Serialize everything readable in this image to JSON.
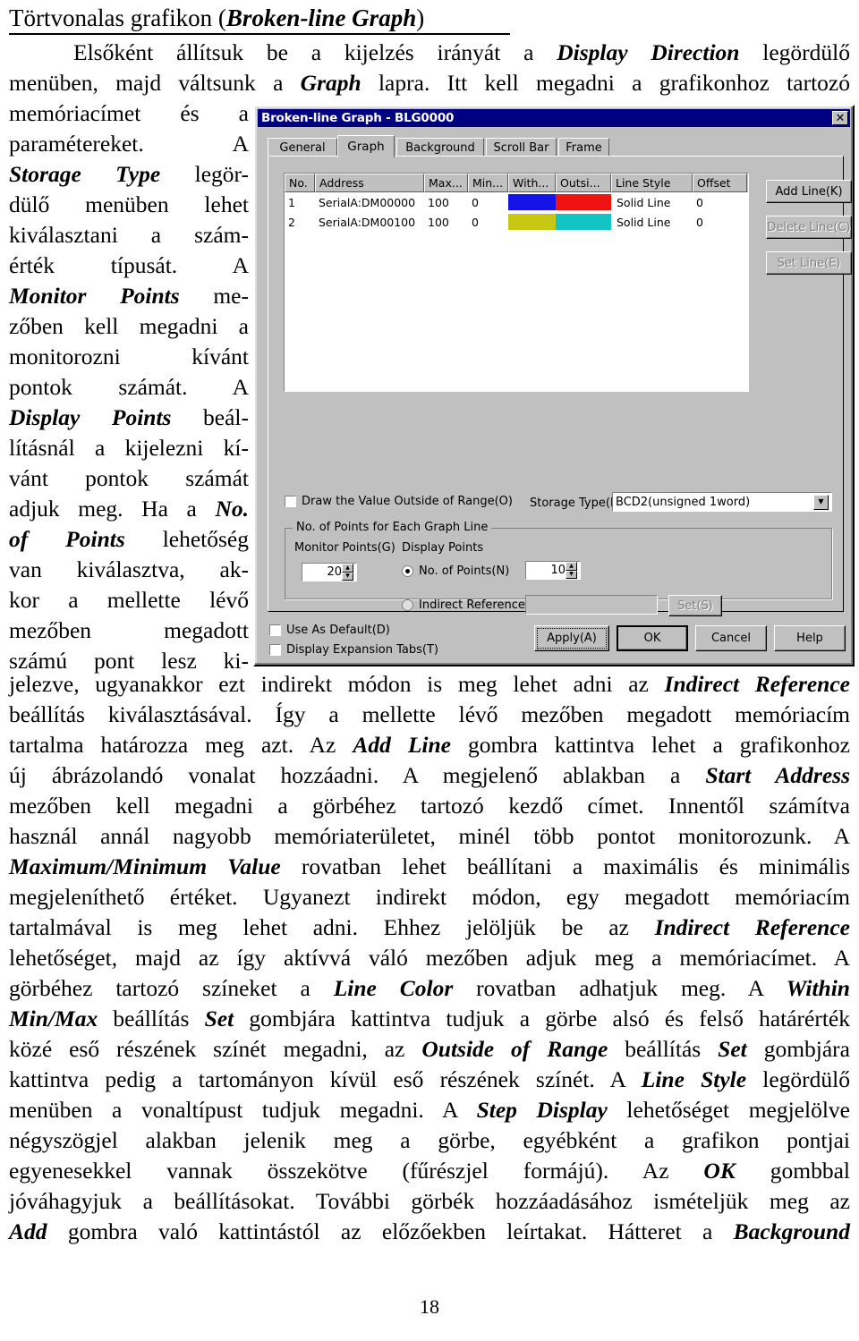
{
  "heading": {
    "text_before": "Törtvonalas grafikon (",
    "emphasis": "Broken-line Graph",
    "text_after": ")"
  },
  "paragraph_top": {
    "line1_a": "Elsőként állítsuk be a kijelzés irányát a ",
    "line1_em": "Display Direction",
    "line1_b": " legördülő",
    "line2_a": "menüben, majd váltsunk a ",
    "line2_em": "Graph",
    "line2_b": " lapra. Itt kell megadni a grafikonhoz tartozó",
    "line3": "memóriacímet és a"
  },
  "left_column": {
    "l1_a": "paramétereket.",
    "l1_b": "A",
    "l2_em": "Storage Type",
    "l2_b": "legör-",
    "l3": "dülő menüben lehet",
    "l4": "kiválasztani a szám-",
    "l5_a": "érték",
    "l5_b": "típusát.",
    "l5_c": "A",
    "l6_em": "Monitor Points",
    "l6_b": "me-",
    "l7": "zőben kell megadni a",
    "l8_a": "monitorozni",
    "l8_b": "kívánt",
    "l9_a": "pontok",
    "l9_b": "számát.",
    "l9_c": "A",
    "l10_em": "Display Points",
    "l10_b": "beál-",
    "l11": "lításnál a kijelezni kí-",
    "l12_a": "vánt",
    "l12_b": "pontok",
    "l12_c": "számát",
    "l13_a": "adjuk meg. Ha a ",
    "l13_em": "No.",
    "l14_em": "of Points",
    "l14_b": "lehetőség",
    "l15": "van kiválasztva, ak-",
    "l16": "kor a mellette lévő",
    "l17_a": "mezőben",
    "l17_b": "megadott",
    "l18": "számú pont lesz ki-"
  },
  "paragraph_bottom": {
    "b1_a": "jelezve, ugyanakkor ezt indirekt módon is meg lehet adni az ",
    "b1_em": "Indirect Reference",
    "b2": "beállítás kiválasztásával. Így a mellette lévő mezőben megadott memóriacím",
    "b3_a": "tartalma határozza meg azt. Az ",
    "b3_em": "Add Line",
    "b3_b": " gombra kattintva lehet a grafikonhoz",
    "b4_a": "új ábrázolandó vonalat hozzáadni. A megjelenő ablakban a ",
    "b4_em": "Start Address",
    "b5": "mezőben kell megadni a görbéhez tartozó kezdő címet. Innentől számítva",
    "b6": "használ annál nagyobb memóriaterületet, minél több pontot monitorozunk. A",
    "b7_em": "Maximum/Minimum Value",
    "b7_b": " rovatban lehet beállítani a maximális és minimális",
    "b8": "megjeleníthető értéket. Ugyanezt indirekt módon, egy megadott memóriacím",
    "b9_a": "tartalmával is meg lehet adni. Ehhez jelöljük be az ",
    "b9_em": "Indirect Reference",
    "b10": "lehetőséget, majd az így aktívvá váló mezőben adjuk meg a memóriacímet. A",
    "b11_a": "görbéhez tartozó színeket a ",
    "b11_em": "Line Color",
    "b11_b": " rovatban adhatjuk meg. A ",
    "b11_em2": "Within",
    "b12_em": "Min/Max",
    "b12_a": " beállítás ",
    "b12_em2": "Set",
    "b12_b": " gombjára kattintva tudjuk a görbe alsó és felső határérték",
    "b13_a": "közé eső részének színét megadni, az ",
    "b13_em": "Outside of Range",
    "b13_b": " beállítás ",
    "b13_em2": "Set",
    "b13_c": " gombjára",
    "b14_a": "kattintva pedig a tartományon kívül eső részének színét. A ",
    "b14_em": "Line Style",
    "b14_b": " legördülő",
    "b15_a": "menüben a vonaltípust tudjuk megadni. A ",
    "b15_em": "Step Display",
    "b15_b": " lehetőséget megjelölve",
    "b16": "négyszögjel alakban jelenik meg a görbe, egyébként a grafikon pontjai",
    "b17_a": "egyenesekkel vannak összekötve (fűrészjel formájú). Az ",
    "b17_em": "OK",
    "b17_b": " gombbal",
    "b18": "jóváhagyjuk a beállításokat. További görbék hozzáadásához ismételjük meg az",
    "b19_em": "Add",
    "b19_a": " gombra való kattintástól az előzőekben leírtakat. Hátteret a ",
    "b19_em2": "Background"
  },
  "page_number": "18",
  "dialog": {
    "title": "Broken-line Graph - BLG0000",
    "close_label": "✕",
    "tabs": [
      {
        "label": "General",
        "active": false
      },
      {
        "label": "Graph",
        "active": true
      },
      {
        "label": "Background",
        "active": false
      },
      {
        "label": "Scroll Bar",
        "active": false
      },
      {
        "label": "Frame",
        "active": false
      }
    ],
    "table": {
      "columns": [
        "No.",
        "Address",
        "Max...",
        "Min...",
        "With...",
        "Outsi...",
        "Line Style",
        "Offset"
      ],
      "rows": [
        {
          "no": "1",
          "address": "SerialA:DM00000",
          "max": "100",
          "min": "0",
          "within_color": "#1414e6",
          "outside_color": "#ef1414",
          "line_style": "Solid Line",
          "offset": "0"
        },
        {
          "no": "2",
          "address": "SerialA:DM00100",
          "max": "100",
          "min": "0",
          "within_color": "#c8c814",
          "outside_color": "#14c3c3",
          "line_style": "Solid Line",
          "offset": "0"
        }
      ]
    },
    "side_buttons": [
      {
        "label": "Add Line(K)",
        "disabled": false
      },
      {
        "label": "Delete Line(C)",
        "disabled": true
      },
      {
        "label": "Set Line(E)",
        "disabled": true
      }
    ],
    "draw_outside": {
      "label": "Draw the Value Outside of Range(O)",
      "checked": false
    },
    "storage_type": {
      "label": "Storage Type(M)",
      "value": "BCD2(unsigned 1word)",
      "arrow": "▼"
    },
    "points_group": {
      "title": "No. of Points for Each Graph Line",
      "monitor_points_label": "Monitor Points(G)",
      "monitor_points_value": "20",
      "display_points_label": "Display Points",
      "no_of_points_label": "No. of Points(N)",
      "no_of_points_value": "10",
      "no_of_points_selected": true,
      "indirect_reference_label": "Indirect Reference(W)",
      "indirect_reference_value": "",
      "indirect_reference_selected": false,
      "set_button": "Set(S)"
    },
    "use_as_default": {
      "label": "Use As Default(D)",
      "checked": false
    },
    "display_expansion": {
      "label": "Display Expansion Tabs(T)",
      "checked": false
    },
    "buttons": [
      {
        "label": "Apply(A)"
      },
      {
        "label": "OK"
      },
      {
        "label": "Cancel"
      },
      {
        "label": "Help"
      }
    ]
  }
}
